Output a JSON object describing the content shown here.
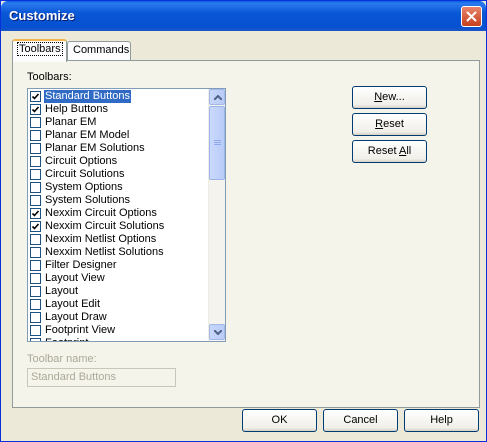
{
  "window": {
    "title": "Customize"
  },
  "tabs": [
    {
      "label": "Toolbars",
      "active": true
    },
    {
      "label": "Commands",
      "active": false
    }
  ],
  "toolbars_label": "Toolbars:",
  "toolbar_list": [
    {
      "label": "Standard Buttons",
      "checked": true,
      "selected": true
    },
    {
      "label": "Help Buttons",
      "checked": true
    },
    {
      "label": "Planar EM",
      "checked": false
    },
    {
      "label": "Planar EM Model",
      "checked": false
    },
    {
      "label": "Planar EM Solutions",
      "checked": false
    },
    {
      "label": "Circuit Options",
      "checked": false
    },
    {
      "label": "Circuit Solutions",
      "checked": false
    },
    {
      "label": "System Options",
      "checked": false
    },
    {
      "label": "System Solutions",
      "checked": false
    },
    {
      "label": "Nexxim Circuit Options",
      "checked": true
    },
    {
      "label": "Nexxim Circuit Solutions",
      "checked": true
    },
    {
      "label": "Nexxim Netlist Options",
      "checked": false
    },
    {
      "label": "Nexxim Netlist Solutions",
      "checked": false
    },
    {
      "label": "Filter Designer",
      "checked": false
    },
    {
      "label": "Layout View",
      "checked": false
    },
    {
      "label": "Layout",
      "checked": false
    },
    {
      "label": "Layout Edit",
      "checked": false
    },
    {
      "label": "Layout Draw",
      "checked": false
    },
    {
      "label": "Footprint View",
      "checked": false
    },
    {
      "label": "Footprint...",
      "checked": false
    }
  ],
  "side_buttons": {
    "new": {
      "label": "New...",
      "mnemonic_index": 0
    },
    "reset": {
      "label": "Reset",
      "mnemonic_index": 0
    },
    "reset_all": {
      "label": "Reset All",
      "mnemonic_index": 6
    }
  },
  "toolbar_name": {
    "label": "Toolbar name:",
    "value": "Standard Buttons"
  },
  "footer": {
    "ok": "OK",
    "cancel": "Cancel",
    "help": "Help"
  },
  "colors": {
    "title_bar": "#0a57d6",
    "selection": "#316ac5",
    "dialog_bg": "#ece9d8",
    "check_mark": "#21a121"
  }
}
